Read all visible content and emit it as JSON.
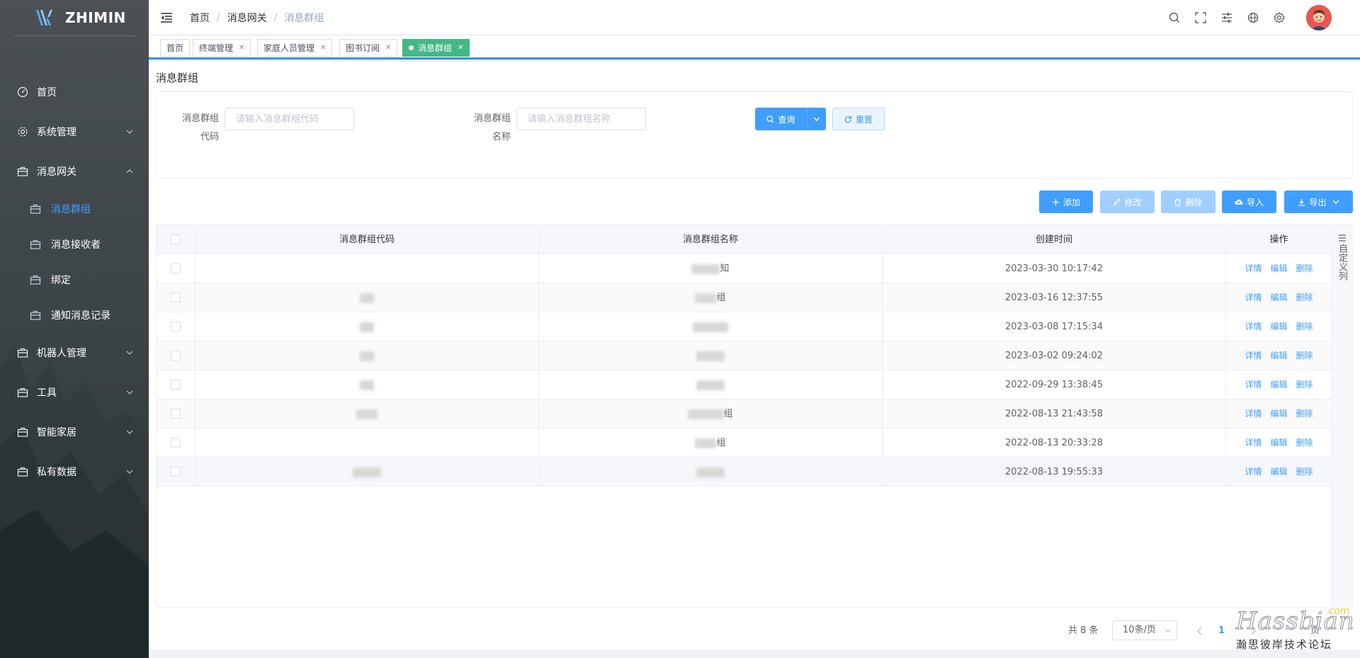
{
  "app": {
    "logo_text": "ZHIMIN"
  },
  "sidebar": {
    "items": [
      {
        "label": "首页",
        "icon": "dashboard-icon"
      },
      {
        "label": "系统管理",
        "icon": "gear-icon",
        "expandable": true
      },
      {
        "label": "消息网关",
        "icon": "briefcase-icon",
        "expandable": true,
        "expanded": true
      },
      {
        "label": "机器人管理",
        "icon": "briefcase-icon",
        "expandable": true
      },
      {
        "label": "工具",
        "icon": "briefcase-icon",
        "expandable": true
      },
      {
        "label": "智能家居",
        "icon": "briefcase-icon",
        "expandable": true
      },
      {
        "label": "私有数据",
        "icon": "briefcase-icon",
        "expandable": true
      }
    ],
    "subitems": [
      {
        "label": "消息群组",
        "active": true
      },
      {
        "label": "消息接收者"
      },
      {
        "label": "绑定"
      },
      {
        "label": "通知消息记录"
      }
    ]
  },
  "header": {
    "breadcrumb": [
      "首页",
      "消息网关",
      "消息群组"
    ]
  },
  "tags": [
    {
      "label": "首页",
      "closable": false
    },
    {
      "label": "终端管理",
      "closable": true
    },
    {
      "label": "家庭人员管理",
      "closable": true
    },
    {
      "label": "图书订阅",
      "closable": true
    },
    {
      "label": "消息群组",
      "closable": true,
      "active": true
    }
  ],
  "page": {
    "title": "消息群组"
  },
  "search": {
    "code_label_1": "消息群组",
    "code_label_2": "代码",
    "code_placeholder": "请输入消息群组代码",
    "name_label_1": "消息群组",
    "name_label_2": "名称",
    "name_placeholder": "请输入消息群组名称",
    "query_label": "查询",
    "reset_label": "重置"
  },
  "toolbar": {
    "add_label": "添加",
    "edit_label": "修改",
    "delete_label": "删除",
    "import_label": "导入",
    "export_label": "导出"
  },
  "table": {
    "headers": [
      "消息群组代码",
      "消息群组名称",
      "创建时间",
      "操作"
    ],
    "custom_columns_label": "自定义列",
    "row_actions": [
      "详情",
      "编辑",
      "删除"
    ],
    "rows": [
      {
        "name_visible": "知",
        "created": "2023-03-30 10:17:42"
      },
      {
        "name_visible": "组",
        "created": "2023-03-16 12:37:55"
      },
      {
        "name_visible": "",
        "created": "2023-03-08 17:15:34"
      },
      {
        "name_visible": "",
        "created": "2023-03-02 09:24:02"
      },
      {
        "name_visible": "",
        "created": "2022-09-29 13:38:45"
      },
      {
        "name_visible": "组",
        "created": "2022-08-13 21:43:58"
      },
      {
        "name_visible": "组",
        "created": "2022-08-13 20:33:28"
      },
      {
        "name_visible": "",
        "created": "2022-08-13 19:55:33"
      }
    ]
  },
  "pagination": {
    "total_text": "共 8 条",
    "page_size": "10条/页",
    "current_page": "1",
    "goto_suffix": "页"
  },
  "watermark": {
    "line1": "Hassbian",
    "line1_suffix": ".com",
    "line2": "瀚思彼岸技术论坛"
  },
  "colors": {
    "primary": "#409eff",
    "active_tag": "#42b983",
    "tag_border": "#3a8ee6"
  }
}
